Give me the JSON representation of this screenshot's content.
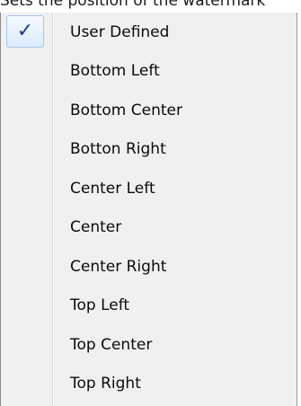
{
  "header_fragment": "Sets the position of the watermark",
  "menu": {
    "items": [
      {
        "label": "User Defined",
        "checked": true
      },
      {
        "label": "Bottom Left",
        "checked": false
      },
      {
        "label": "Bottom Center",
        "checked": false
      },
      {
        "label": "Botton Right",
        "checked": false
      },
      {
        "label": "Center Left",
        "checked": false
      },
      {
        "label": "Center",
        "checked": false
      },
      {
        "label": "Center Right",
        "checked": false
      },
      {
        "label": "Top Left",
        "checked": false
      },
      {
        "label": "Top Center",
        "checked": false
      },
      {
        "label": "Top Right",
        "checked": false
      }
    ],
    "check_glyph": "✓",
    "check_icon": "checkmark-icon"
  }
}
